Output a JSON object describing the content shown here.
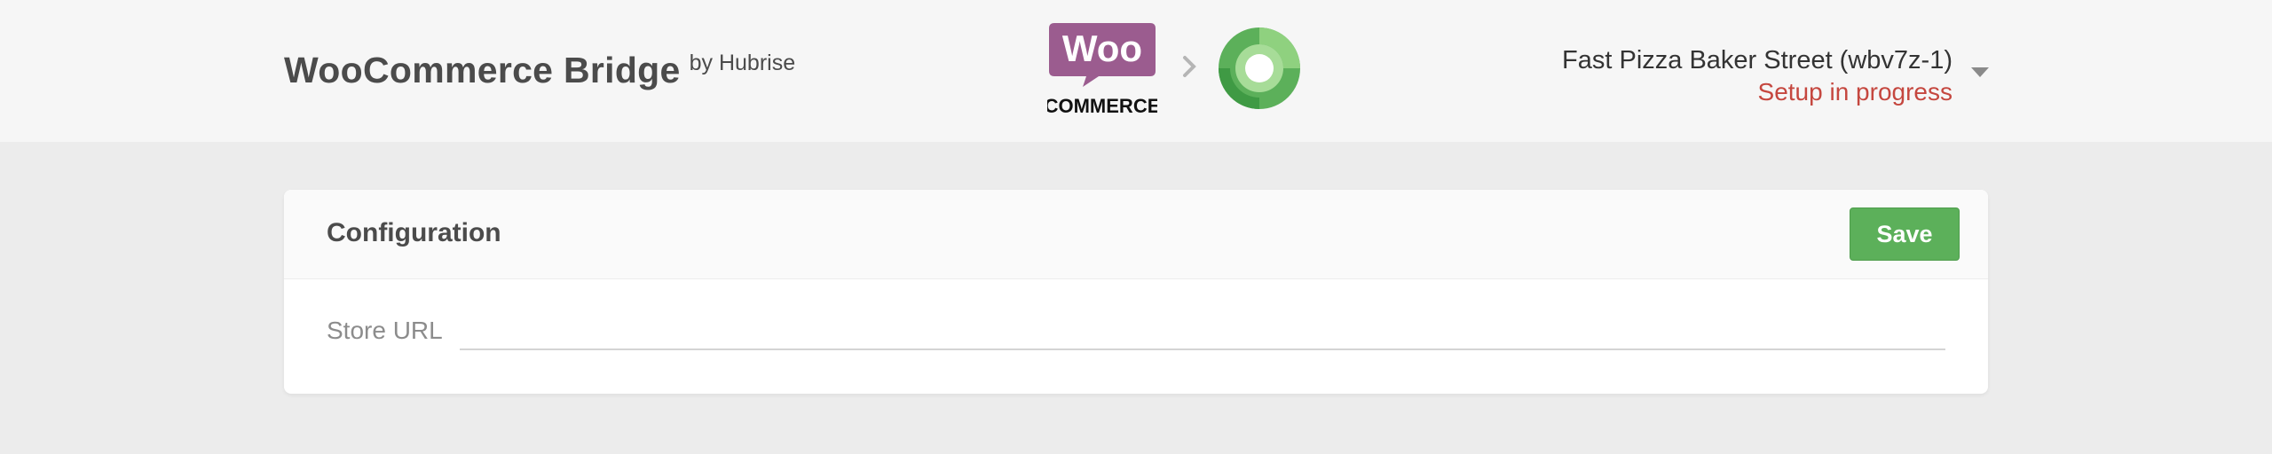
{
  "header": {
    "app_title": "WooCommerce Bridge",
    "by_text": "by Hubrise",
    "woo_logo": {
      "top": "Woo",
      "bottom": "COMMERCE",
      "color": "#9b5c8f"
    },
    "hubrise_logo_color": "#5cb05a"
  },
  "account": {
    "name": "Fast Pizza Baker Street (wbv7z-1)",
    "status": "Setup in progress",
    "status_color": "#c5473f"
  },
  "configuration": {
    "title": "Configuration",
    "save_label": "Save",
    "fields": [
      {
        "label": "Store URL",
        "value": "",
        "placeholder": ""
      }
    ]
  }
}
